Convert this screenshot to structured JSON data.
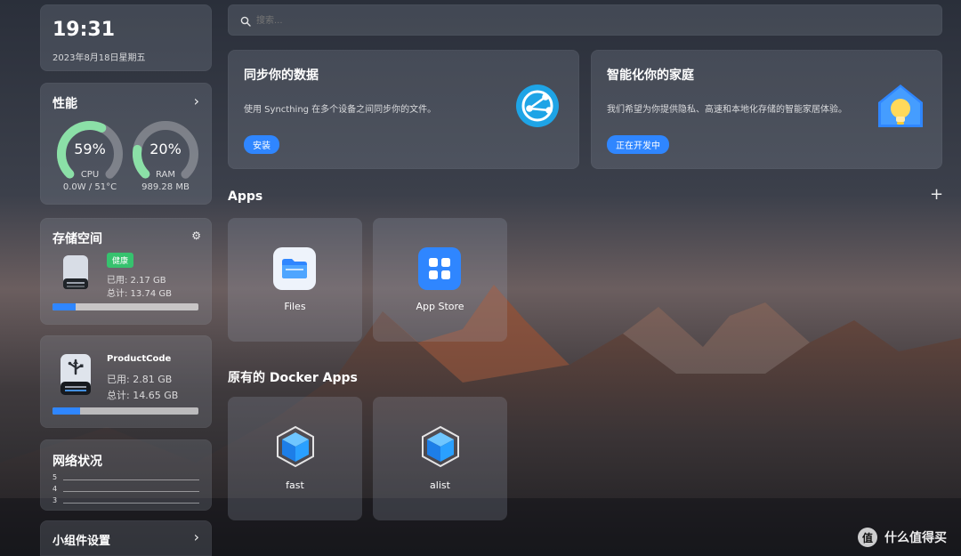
{
  "sidebar": {
    "time": "19:31",
    "date": "2023年8月18日星期五",
    "performance": {
      "title": "性能",
      "cpu": {
        "percent_text": "59%",
        "label": "CPU",
        "detail": "0.0W / 51°C",
        "value": 59
      },
      "ram": {
        "percent_text": "20%",
        "label": "RAM",
        "detail": "989.28 MB",
        "value": 20
      }
    },
    "storage": {
      "title": "存储空间",
      "badge": "健康",
      "used": "已用: 2.17 GB",
      "total": "总计: 13.74 GB",
      "usage_fraction": 0.16
    },
    "usb": {
      "name": "ProductCode",
      "used": "已用: 2.81 GB",
      "total": "总计: 14.65 GB",
      "usage_fraction": 0.19
    },
    "network": {
      "title": "网络状况",
      "ticks": [
        "5",
        "4",
        "3"
      ]
    },
    "widgets": {
      "title": "小组件设置"
    }
  },
  "search": {
    "placeholder": "搜索..."
  },
  "promos": [
    {
      "title": "同步你的数据",
      "desc": "使用 Syncthing 在多个设备之间同步你的文件。",
      "button": "安装"
    },
    {
      "title": "智能化你的家庭",
      "desc": "我们希望为你提供隐私、高速和本地化存储的智能家居体验。",
      "button": "正在开发中"
    }
  ],
  "apps": {
    "title": "Apps",
    "add": "+",
    "items": [
      {
        "label": "Files"
      },
      {
        "label": "App Store"
      }
    ]
  },
  "docker": {
    "title": "原有的 Docker Apps",
    "items": [
      {
        "label": "fast"
      },
      {
        "label": "alist"
      }
    ]
  },
  "watermark": {
    "text": "什么值得买"
  },
  "colors": {
    "accent": "#2f86ff",
    "healthy": "#36c26e",
    "gauge_green": "#8be0a7"
  }
}
